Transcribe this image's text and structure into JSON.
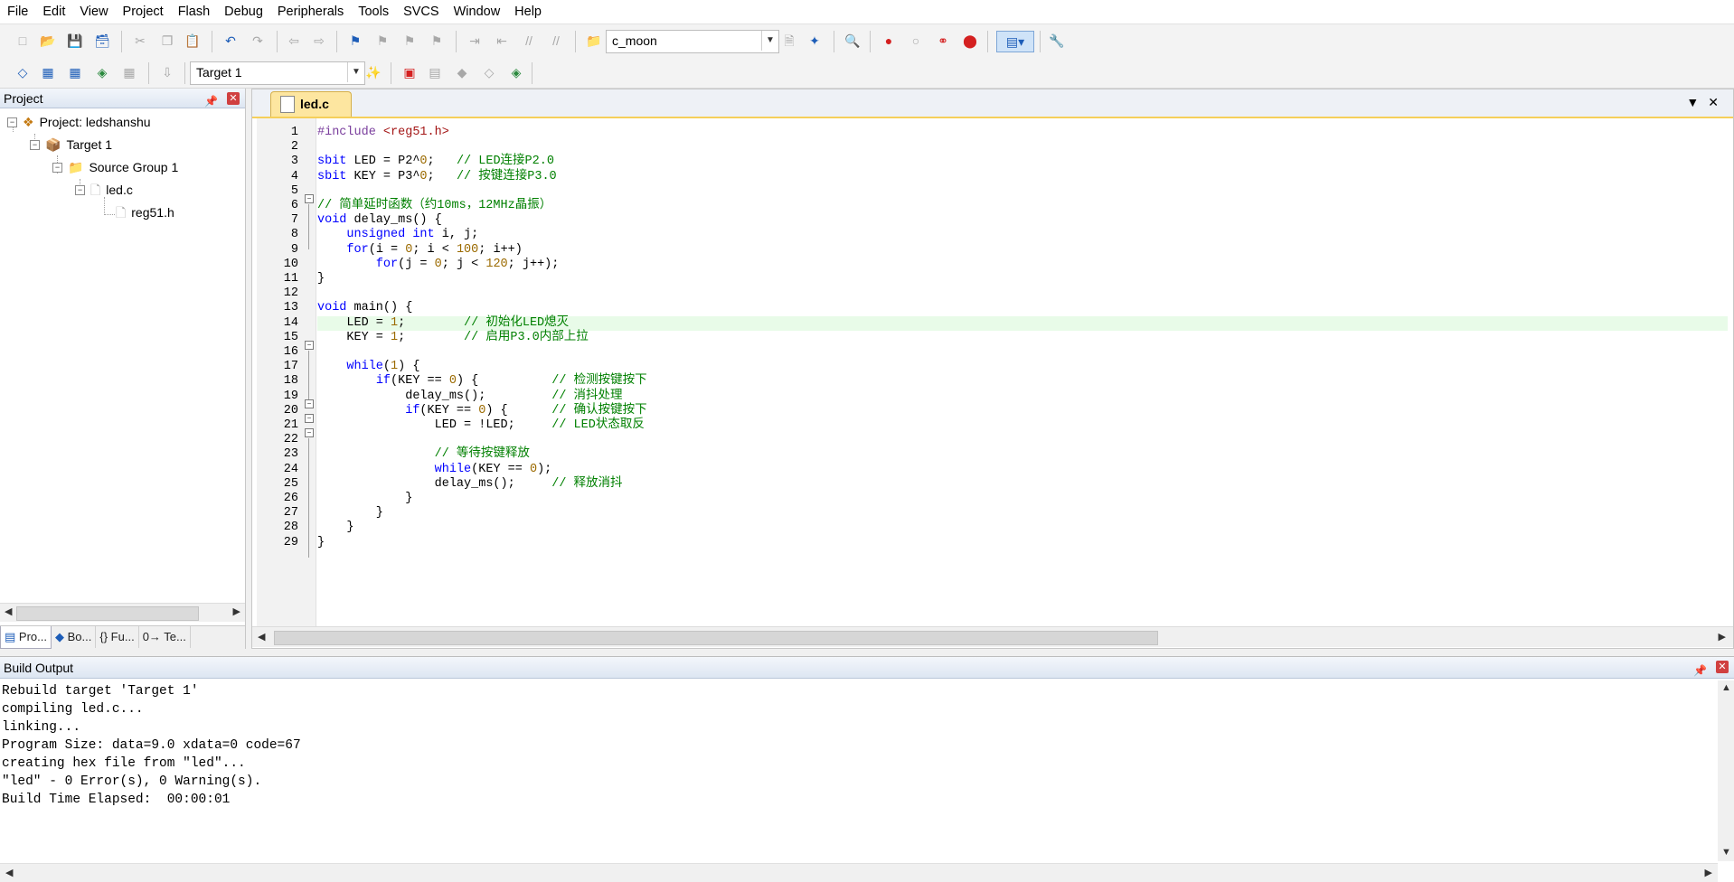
{
  "menu": [
    "File",
    "Edit",
    "View",
    "Project",
    "Flash",
    "Debug",
    "Peripherals",
    "Tools",
    "SVCS",
    "Window",
    "Help"
  ],
  "toolbar": {
    "target_value": "c_moon",
    "build_target_value": "Target 1"
  },
  "project_panel": {
    "title": "Project",
    "tree": {
      "project": "Project: ledshanshu",
      "target": "Target 1",
      "group": "Source Group 1",
      "file": "led.c",
      "header": "reg51.h"
    },
    "tabs": [
      "Pro...",
      "Bo...",
      "{} Fu...",
      "0→ Te..."
    ]
  },
  "editor": {
    "tab": "led.c",
    "lines": [
      "#include <reg51.h>",
      "",
      "sbit LED = P2^0;   // LED连接P2.0",
      "sbit KEY = P3^0;   // 按键连接P3.0",
      "",
      "// 简单延时函数（约10ms，12MHz晶振）",
      "void delay_ms() {",
      "    unsigned int i, j;",
      "    for(i = 0; i < 100; i++)",
      "        for(j = 0; j < 120; j++);",
      "}",
      "",
      "void main() {",
      "    LED = 1;        // 初始化LED熄灭",
      "    KEY = 1;        // 启用P3.0内部上拉",
      "",
      "    while(1) {",
      "        if(KEY == 0) {          // 检测按键按下",
      "            delay_ms();         // 消抖处理",
      "            if(KEY == 0) {      // 确认按键按下",
      "                LED = !LED;     // LED状态取反",
      "",
      "                // 等待按键释放",
      "                while(KEY == 0);",
      "                delay_ms();     // 释放消抖",
      "            }",
      "        }",
      "    }",
      "}"
    ]
  },
  "build_output": {
    "title": "Build Output",
    "lines": [
      "Rebuild target 'Target 1'",
      "compiling led.c...",
      "linking...",
      "Program Size: data=9.0 xdata=0 code=67",
      "creating hex file from \"led\"...",
      "\"led\" - 0 Error(s), 0 Warning(s).",
      "Build Time Elapsed:  00:00:01"
    ]
  },
  "colors": {
    "keyword": "#0000ff",
    "comment": "#008000",
    "number": "#9b6a00",
    "active_tab": "#fde6a0",
    "current_line": "#e8fbe8"
  }
}
